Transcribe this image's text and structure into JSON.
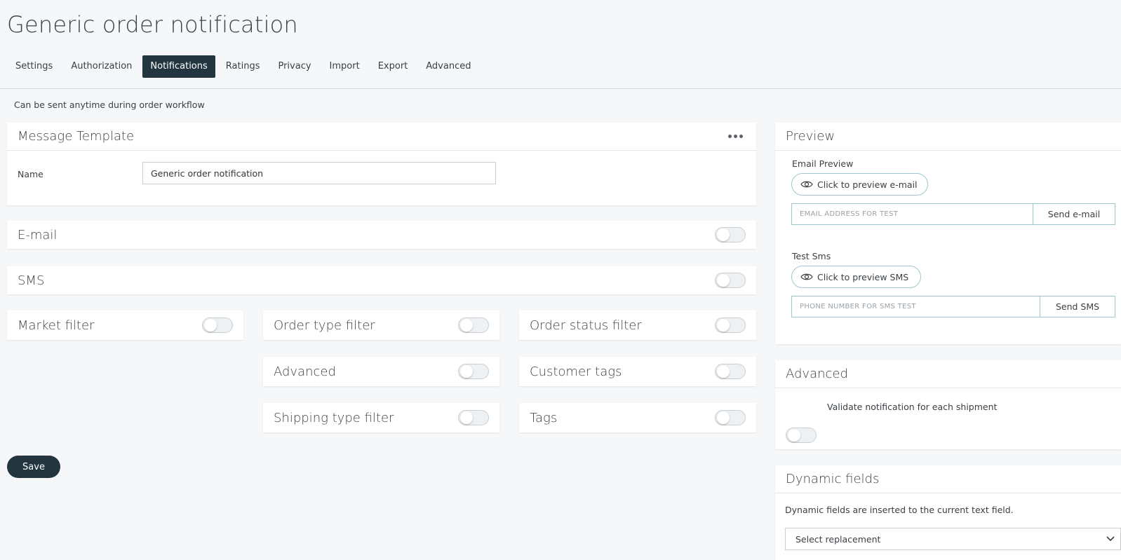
{
  "page": {
    "title": "Generic order notification",
    "subtitle": "Can be sent anytime during order workflow"
  },
  "tabs": [
    {
      "label": "Settings",
      "active": false
    },
    {
      "label": "Authorization",
      "active": false
    },
    {
      "label": "Notifications",
      "active": true
    },
    {
      "label": "Ratings",
      "active": false
    },
    {
      "label": "Privacy",
      "active": false
    },
    {
      "label": "Import",
      "active": false
    },
    {
      "label": "Export",
      "active": false
    },
    {
      "label": "Advanced",
      "active": false
    }
  ],
  "message_template": {
    "title": "Message Template",
    "name_label": "Name",
    "name_value": "Generic order notification"
  },
  "channels": {
    "email": {
      "label": "E-mail",
      "enabled": false
    },
    "sms": {
      "label": "SMS",
      "enabled": false
    }
  },
  "filters": {
    "market": {
      "label": "Market filter",
      "enabled": false
    },
    "order_type": {
      "label": "Order type filter",
      "enabled": false
    },
    "order_status": {
      "label": "Order status filter",
      "enabled": false
    },
    "advanced": {
      "label": "Advanced",
      "enabled": false
    },
    "customer_tags": {
      "label": "Customer tags",
      "enabled": false
    },
    "shipping_type": {
      "label": "Shipping type filter",
      "enabled": false
    },
    "tags": {
      "label": "Tags",
      "enabled": false
    }
  },
  "save_label": "Save",
  "preview": {
    "title": "Preview",
    "email_label": "Email Preview",
    "email_preview_btn": "Click to preview e-mail",
    "email_placeholder": "EMAIL ADDRESS FOR TEST",
    "send_email_btn": "Send e-mail",
    "sms_label": "Test Sms",
    "sms_preview_btn": "Click to preview SMS",
    "sms_placeholder": "PHONE NUMBER FOR SMS TEST",
    "send_sms_btn": "Send SMS"
  },
  "advanced_panel": {
    "title": "Advanced",
    "validate_label": "Validate notification for each shipment",
    "validate_enabled": false
  },
  "dynamic_fields": {
    "title": "Dynamic fields",
    "description": "Dynamic fields are inserted to the current text field.",
    "select_value": "Select replacement"
  },
  "icons": {
    "eye": "eye-icon",
    "more": "more-horizontal-icon",
    "chevron": "chevron-down-icon"
  }
}
